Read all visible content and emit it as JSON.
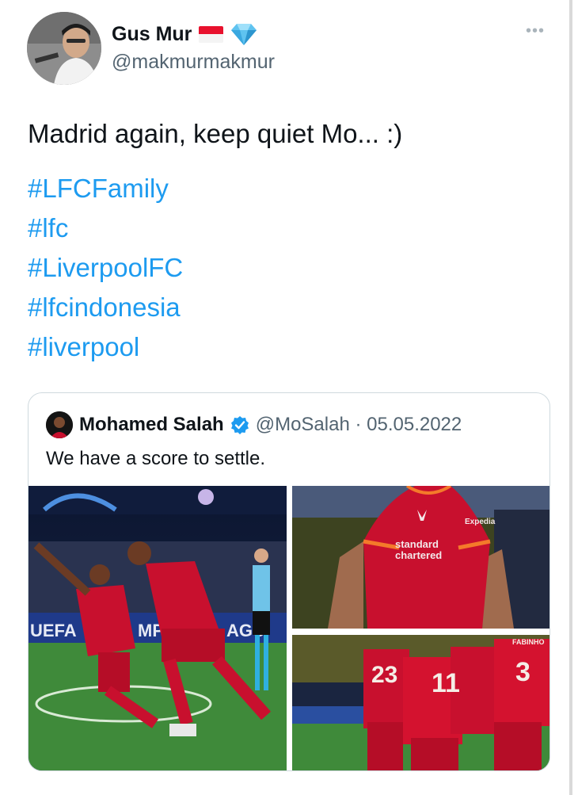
{
  "tweet": {
    "display_name": "Gus Mur",
    "handle": "@makmurmakmur",
    "more_label": "•••",
    "text": "Madrid again, keep quiet Mo... :)",
    "hashtags": [
      "#LFCFamily",
      "#lfc",
      "#LiverpoolFC",
      "#lfcindonesia",
      "#liverpool"
    ],
    "badges": {
      "flag": "indonesia-flag-icon",
      "gem": "diamond-icon"
    }
  },
  "quote": {
    "display_name": "Mohamed Salah",
    "handle_date": "@MoSalah · 05.05.2022",
    "text": "We have a score to settle.",
    "verified_icon": "verified-badge-icon",
    "images": [
      {
        "name": "celebration-photo",
        "board_text": "UEFA",
        "board_text2": "MPIO",
        "board_text3": "AGU"
      },
      {
        "name": "jersey-closeup-photo",
        "sponsor_line1": "standard",
        "sponsor_line2": "chartered",
        "brand": "Expedia"
      },
      {
        "name": "team-huddle-photo",
        "numbers": [
          "23",
          "11",
          "3"
        ],
        "player_name": "FABINHO"
      }
    ]
  },
  "colors": {
    "link": "#1d9bf0",
    "muted": "#536471",
    "border": "#cfd9de",
    "liverpool_red": "#c8102e"
  }
}
